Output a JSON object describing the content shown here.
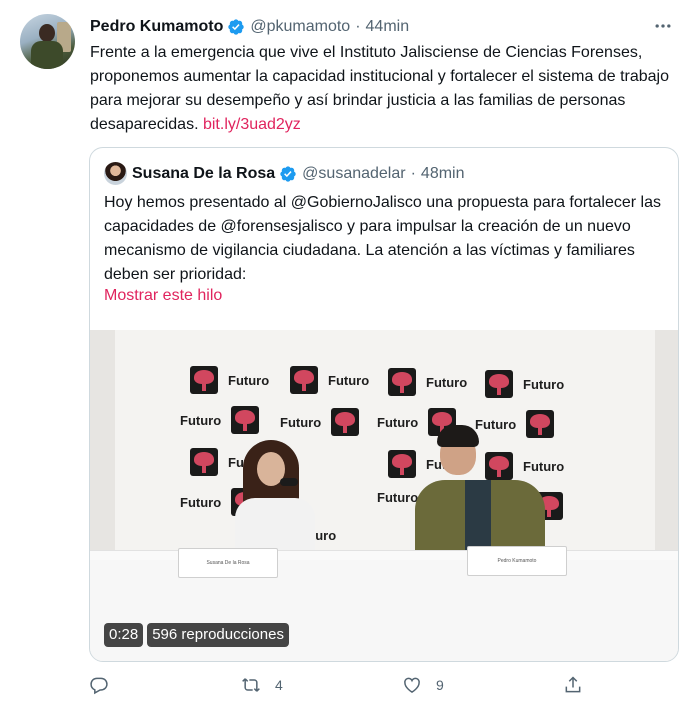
{
  "tweet": {
    "author_name": "Pedro Kumamoto",
    "handle": "@pkumamoto",
    "separator": "·",
    "time": "44min",
    "text": "Frente a la emergencia que vive el Instituto Jalisciense de Ciencias Forenses, proponemos aumentar la capacidad institucional y fortalecer el sistema de trabajo para mejorar su desempeño y así brindar justicia a las familias de personas desaparecidas.",
    "link": "bit.ly/3uad2yz",
    "more_icon": "more-dots-icon"
  },
  "quote": {
    "author_name": "Susana De la Rosa",
    "handle": "@susanadelar",
    "separator": "·",
    "time": "48min",
    "text": "Hoy hemos presentado al @GobiernoJalisco una propuesta para fortalecer las capacidades de @forensesjalisco y para impulsar la creación de un nuevo mecanismo de vigilancia ciudadana. La atención a las víctimas y familiares deben ser prioridad:",
    "show_thread": "Mostrar este hilo",
    "video": {
      "duration": "0:28",
      "views": "596 reproducciones",
      "backdrop_word": "Futuro",
      "placard_left": "Susana De la Rosa",
      "placard_right": "Pedro Kumamoto"
    }
  },
  "actions": {
    "reply_count": "",
    "retweet_count": "4",
    "like_count": "9",
    "share_count": ""
  },
  "colors": {
    "link": "#e0245e",
    "verified": "#1d9bf0",
    "secondary_text": "#536471",
    "border": "#cfd9de"
  }
}
